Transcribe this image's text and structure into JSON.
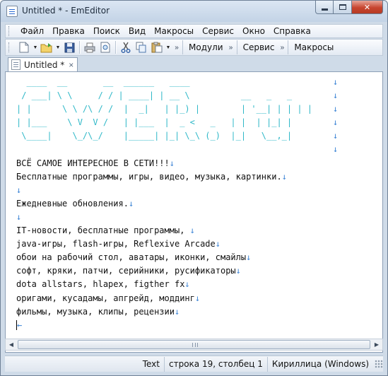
{
  "window": {
    "title": "Untitled * - EmEditor"
  },
  "menu": {
    "items": [
      "Файл",
      "Правка",
      "Поиск",
      "Вид",
      "Макросы",
      "Сервис",
      "Окно",
      "Справка"
    ]
  },
  "toolbar": {
    "buttons": [
      "new-file-icon",
      "open-folder-icon",
      "save-icon",
      "print-icon",
      "print-preview-icon",
      "cut-icon",
      "copy-icon",
      "paste-icon"
    ],
    "segments": [
      "Модули",
      "Сервис",
      "Макросы"
    ]
  },
  "tab": {
    "label": "Untitled *",
    "close": "×"
  },
  "editor": {
    "eol_mark": "↓",
    "eof_mark": "←",
    "ascii_lines": [
      "  ____  __       __  ______   ____",
      " / ___| \\ \\     / / | ____| | __ \\          __   _   _",
      "| |      \\ \\ /\\ / /  |  _|   | |_) |        | '__| | | | |",
      "| |___    \\ V  V /   | |___  |  _ <   _   | |  | |_| |",
      " \\____|    \\_/\\_/    |_____| |_| \\_\\ (_)  |_|   \\__,_|",
      ""
    ],
    "text_lines": [
      "ВСЁ САМОЕ ИНТЕРЕСНОЕ В СЕТИ!!!",
      "Бесплатные программы, игры, видео, музыка, картинки.",
      "",
      "Ежедневные обновления.",
      "",
      "IT-новости, бесплатные программы, ",
      "java-игры, flash-игры, Reflexive Arcade",
      "обои на рабочий стол, аватары, иконки, смайлы",
      "софт, кряки, патчи, серийники, русификаторы",
      "dota allstars, hlapex, figther fx",
      "оригами, кусадамы, апгрейд, моддинг",
      "фильмы, музыка, клипы, рецензии"
    ]
  },
  "status": {
    "mode": "Text",
    "position": "строка 19, столбец 1",
    "encoding": "Кириллица (Windows)"
  }
}
